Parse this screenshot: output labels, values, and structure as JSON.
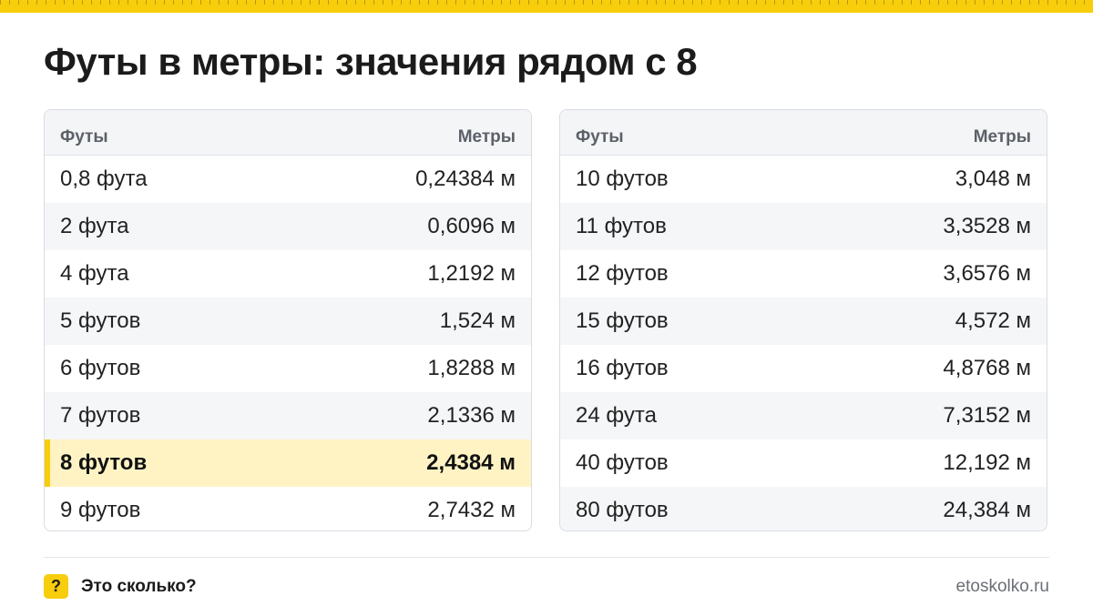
{
  "title": "Футы в метры: значения рядом с 8",
  "tables": [
    {
      "headers": {
        "feet": "Футы",
        "meters": "Метры"
      },
      "rows": [
        {
          "feet": "0,8 фута",
          "meters": "0,24384 м"
        },
        {
          "feet": "2 фута",
          "meters": "0,6096 м"
        },
        {
          "feet": "4 фута",
          "meters": "1,2192 м"
        },
        {
          "feet": "5 футов",
          "meters": "1,524 м"
        },
        {
          "feet": "6 футов",
          "meters": "1,8288 м"
        },
        {
          "feet": "7 футов",
          "meters": "2,1336 м"
        },
        {
          "feet": "8 футов",
          "meters": "2,4384 м"
        },
        {
          "feet": "9 футов",
          "meters": "2,7432 м"
        }
      ]
    },
    {
      "headers": {
        "feet": "Футы",
        "meters": "Метры"
      },
      "rows": [
        {
          "feet": "10 футов",
          "meters": "3,048 м"
        },
        {
          "feet": "11 футов",
          "meters": "3,3528 м"
        },
        {
          "feet": "12 футов",
          "meters": "3,6576 м"
        },
        {
          "feet": "15 футов",
          "meters": "4,572 м"
        },
        {
          "feet": "16 футов",
          "meters": "4,8768 м"
        },
        {
          "feet": "24 фута",
          "meters": "7,3152 м"
        },
        {
          "feet": "40 футов",
          "meters": "12,192 м"
        },
        {
          "feet": "80 футов",
          "meters": "24,384 м"
        }
      ]
    }
  ],
  "footer": {
    "icon_glyph": "?",
    "brand": "Это сколько?",
    "site": "etoskolko.ru"
  },
  "colors": {
    "accent": "#f7cd0c",
    "highlight_row": "#fff3c4"
  }
}
